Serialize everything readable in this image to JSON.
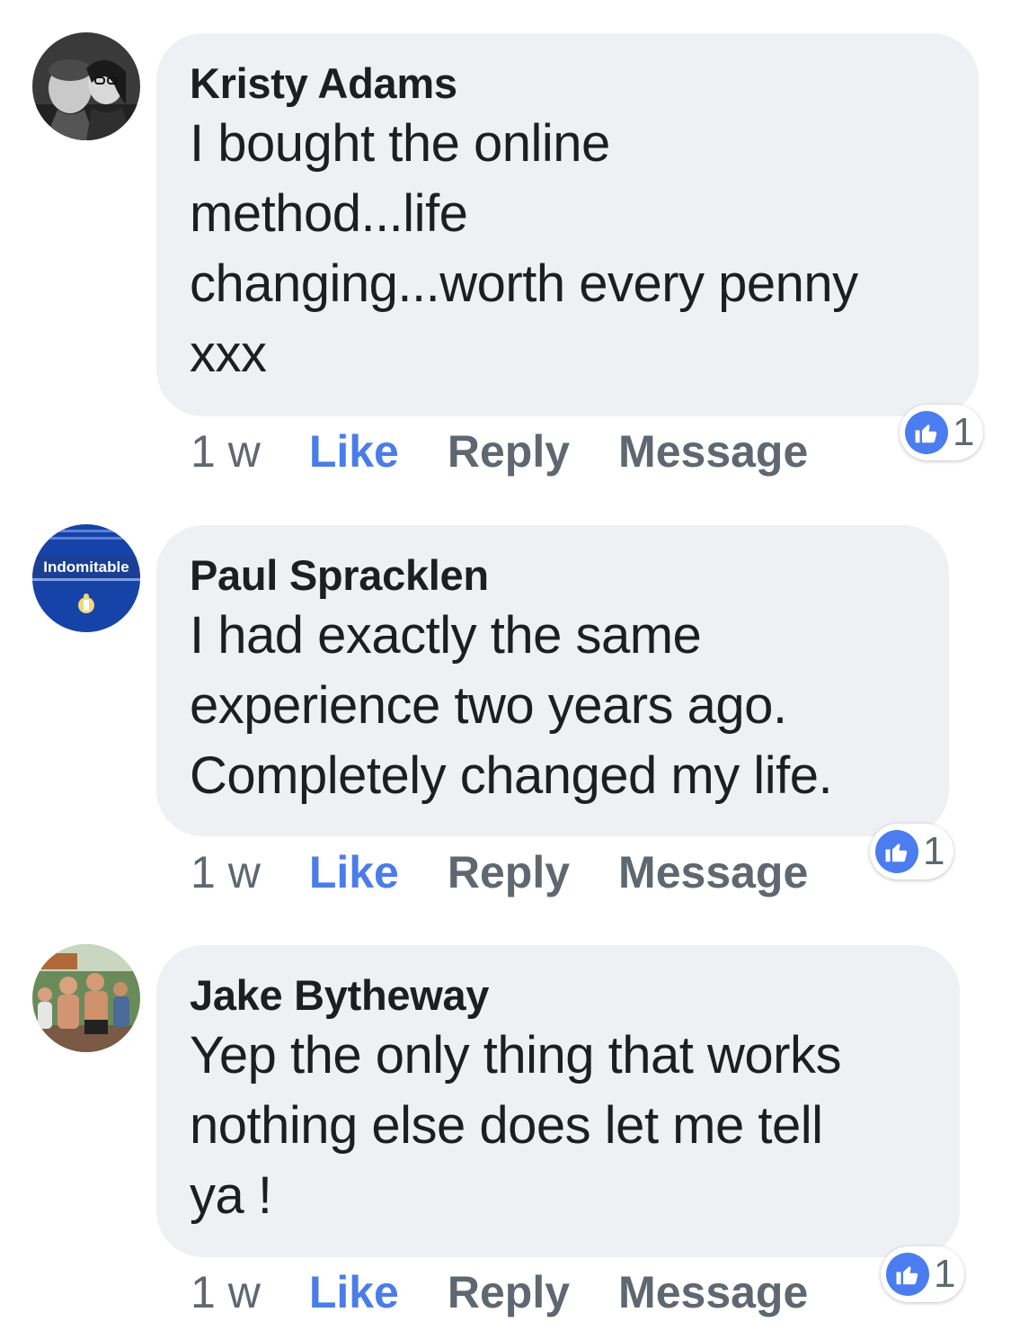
{
  "comments": [
    {
      "author": "Kristy Adams",
      "text": "I bought the online\nmethod...life\nchanging...worth every penny\nxxx",
      "time": "1 w",
      "like_label": "Like",
      "reply_label": "Reply",
      "message_label": "Message",
      "reaction_count": "1",
      "avatar_icon": "couple-photo-avatar"
    },
    {
      "author": "Paul Spracklen",
      "text": "I had exactly the same\nexperience two years ago.\nCompletely changed my life.",
      "time": "1 w",
      "like_label": "Like",
      "reply_label": "Reply",
      "message_label": "Message",
      "reaction_count": "1",
      "avatar_icon": "indomitable-badge-avatar",
      "avatar_text": "Indomitable"
    },
    {
      "author": "Jake Bytheway",
      "text": "Yep the only thing that works\nnothing else does let me tell\nya !",
      "time": "1 w",
      "like_label": "Like",
      "reply_label": "Reply",
      "message_label": "Message",
      "reaction_count": "1",
      "avatar_icon": "group-photo-avatar"
    }
  ],
  "colors": {
    "bubble": "#eff0f3",
    "like": "#4a7de8",
    "meta": "#606770",
    "text": "#1c1e21",
    "reaction": "#4b7cf0"
  }
}
